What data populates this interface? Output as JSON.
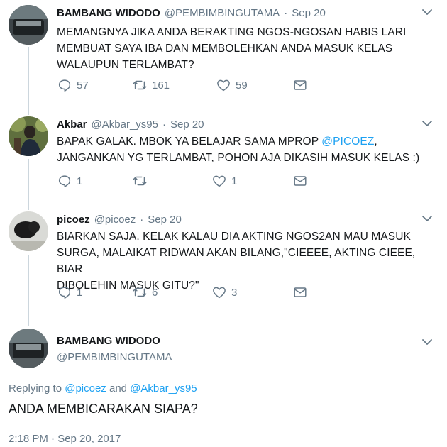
{
  "tweets": [
    {
      "name": "BAMBANG WIDODO",
      "handle": "@PEMBIMBINGUTAMA",
      "date": "Sep 20",
      "text_lines": [
        "MEMANGNYA JIKA ANDA BERAKTING NGOS-NGOSAN HABIS LARI",
        "MEMBUAT SAYA IBA DAN MEMBOLEHKAN ANDA MASUK KELAS",
        "WALAUPUN TERLAMBAT?"
      ],
      "replies": "57",
      "retweets": "161",
      "likes": "59"
    },
    {
      "name": "Akbar",
      "handle": "@Akbar_ys95",
      "date": "Sep 20",
      "text_line1_pre": "BAPAK GALAK. MBOK YA BELAJAR SAMA MPROP ",
      "text_line1_mention": "@PICOEZ",
      "text_line1_post": ",",
      "text_line2": "JANGANKAN YG TERLAMBAT, POHON AJA DIKASIH MASUK KELAS :)",
      "replies": "1",
      "retweets": "",
      "likes": "1"
    },
    {
      "name": "picoez",
      "handle": "@picoez",
      "date": "Sep 20",
      "text_lines": [
        "BIARKAN SAJA. KELAK KALAU DIA AKTING NGOS2AN MAU MASUK",
        "SURGA, MALAIKAT RIDWAN AKAN BILANG,\"CIEEEE, AKTING CIEEE, BIAR",
        "DIBOLEHIN MASUK GITU?\""
      ],
      "replies": "1",
      "retweets": "6",
      "likes": "3"
    }
  ],
  "main_tweet": {
    "name": "BAMBANG WIDODO",
    "handle": "@PEMBIMBINGUTAMA",
    "replying_prefix": "Replying to ",
    "replying_mention1": "@picoez",
    "replying_and": " and ",
    "replying_mention2": "@Akbar_ys95",
    "text": "ANDA MEMBICARAKAN SIAPA?",
    "timestamp": "2:18 PM · Sep 20, 2017"
  },
  "icons": {
    "reply": "reply-icon",
    "retweet": "retweet-icon",
    "like": "heart-icon",
    "dm": "envelope-icon",
    "menu": "chevron-down-icon"
  },
  "colors": {
    "text": "#14171a",
    "secondary": "#657786",
    "link": "#1da1f2",
    "thread_line": "#ccd6dd"
  }
}
